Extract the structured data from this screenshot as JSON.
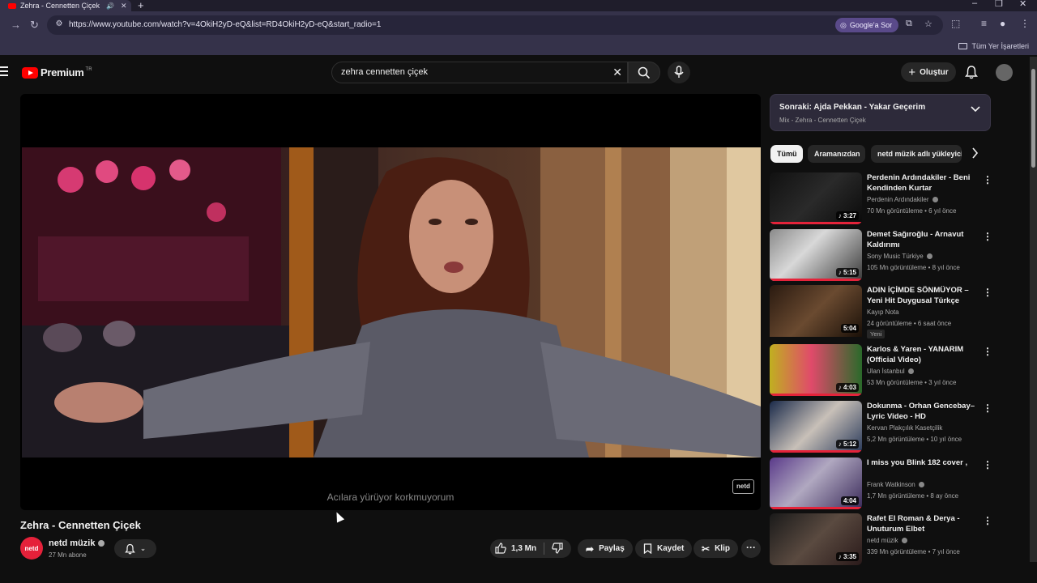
{
  "browser": {
    "tab_title": "Zehra - Cennetten Çiçek - Y",
    "new_tab_icon": "plus-icon",
    "url": "https://www.youtube.com/watch?v=4OkiH2yD-eQ&list=RD4OkiH2yD-eQ&start_radio=1",
    "google_ask_label": "Google'a Sor",
    "bookmarks_label": "Tüm Yer İşaretleri"
  },
  "masthead": {
    "brand": "Premium",
    "region": "TR",
    "search_query": "zehra cennetten çiçek",
    "create_label": "Oluştur"
  },
  "player": {
    "subtitle": "Acılara yürüyor korkmuyorum",
    "watermark": "netd"
  },
  "video": {
    "title": "Zehra - Cennetten Çiçek",
    "channel": "netd müzik",
    "channel_avatar_text": "netd",
    "subscribers": "27 Mn abone",
    "likes": "1,3 Mn",
    "share_label": "Paylaş",
    "save_label": "Kaydet",
    "clip_label": "Klip",
    "more_label": "···"
  },
  "next_up": {
    "title": "Sonraki: Ajda Pekkan - Yakar Geçerim",
    "subtitle": "Mix - Zehra - Cennetten Çiçek"
  },
  "chips": [
    "Tümü",
    "Aramanızdan",
    "netd müzik adlı yükleyici"
  ],
  "recommendations": [
    {
      "title": "Perdenin Ardındakiler - Beni Kendinden Kurtar",
      "channel": "Perdenin Ardındakiler",
      "verified": true,
      "meta": "70 Mn görüntüleme • 6 yıl önce",
      "duration": "♪ 3:27",
      "badge": ""
    },
    {
      "title": "Demet Sağıroğlu - Arnavut Kaldırımı",
      "channel": "Sony Music Türkiye",
      "verified": true,
      "meta": "105 Mn görüntüleme • 8 yıl önce",
      "duration": "♪ 5:15",
      "badge": ""
    },
    {
      "title": "ADIN İÇİMDE SÖNMÜYOR – Yeni Hit Duygusal Türkçe Şarkı...",
      "channel": "Kayıp Nota",
      "verified": false,
      "meta": "24 görüntüleme • 6 saat önce",
      "duration": "5:04",
      "badge": "Yeni"
    },
    {
      "title": "Karlos & Yaren - YANARIM (Official Video)",
      "channel": "Ulan İstanbul",
      "verified": true,
      "meta": "53 Mn görüntüleme • 3 yıl önce",
      "duration": "♪ 4:03",
      "badge": ""
    },
    {
      "title": "Dokunma - Orhan Gencebay– Lyric Video - HD",
      "channel": "Kervan Plakçılık Kasetçilik",
      "verified": false,
      "meta": "5,2 Mn görüntüleme • 10 yıl önce",
      "duration": "♪ 5:12",
      "badge": ""
    },
    {
      "title": "I miss you Blink 182 cover ,",
      "channel": "Frank Watkinson",
      "verified": true,
      "meta": "1,7 Mn görüntüleme • 8 ay önce",
      "duration": "4:04",
      "badge": ""
    },
    {
      "title": "Rafet El Roman & Derya - Unuturum Elbet",
      "channel": "netd müzik",
      "verified": true,
      "meta": "339 Mn görüntüleme • 7 yıl önce",
      "duration": "♪ 3:35",
      "badge": ""
    }
  ],
  "colors": {
    "accent": "#ff0000",
    "progress": "#e4233a",
    "background": "#0f0f0f",
    "browser_chrome": "#35324a"
  }
}
